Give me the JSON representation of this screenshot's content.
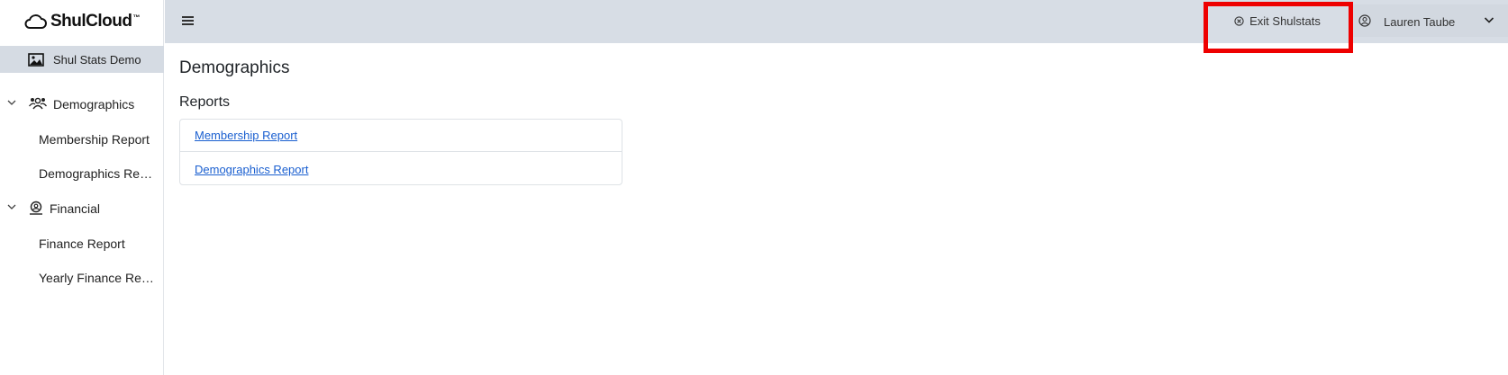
{
  "brand": {
    "name": "ShulCloud",
    "tm": "™"
  },
  "sidebar": {
    "org_name": "Shul Stats Demo",
    "groups": [
      {
        "label": "Demographics",
        "icon": "people-group-icon",
        "items": [
          {
            "label": "Membership Report"
          },
          {
            "label": "Demographics Report"
          }
        ]
      },
      {
        "label": "Financial",
        "icon": "money-icon",
        "items": [
          {
            "label": "Finance Report"
          },
          {
            "label": "Yearly Finance Report"
          }
        ]
      }
    ]
  },
  "topbar": {
    "menu_icon": "hamburger-icon",
    "exit_label": "Exit Shulstats",
    "user_name": "Lauren Taube",
    "highlight_color": "#ee0000"
  },
  "main": {
    "title": "Demographics",
    "section_title": "Reports",
    "reports": [
      {
        "label": "Membership Report"
      },
      {
        "label": "Demographics Report"
      }
    ]
  },
  "colors": {
    "topbar_bg": "#d7dde5",
    "active_bg": "#d5dbe3",
    "link": "#1a5fd0"
  }
}
